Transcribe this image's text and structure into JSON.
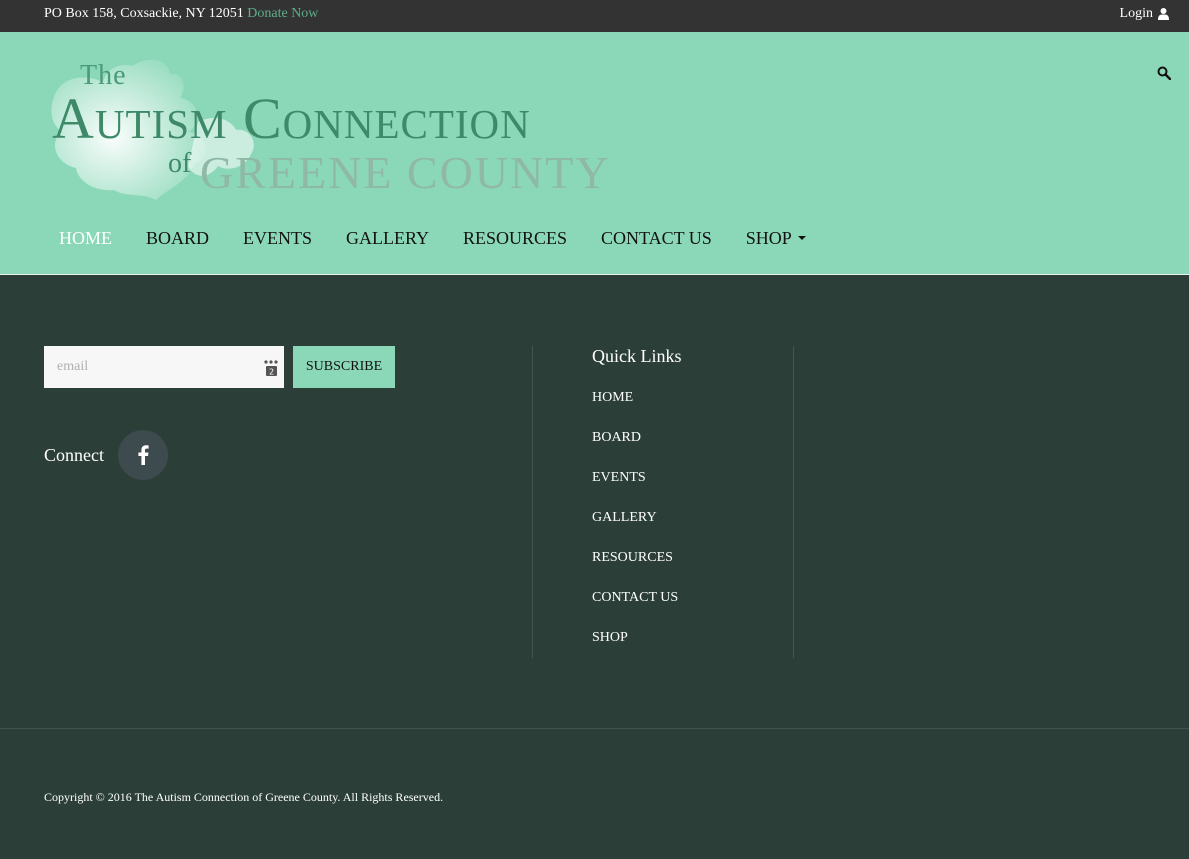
{
  "topbar": {
    "address": "PO Box 158, Coxsackie, NY 12051",
    "donate_label": "Donate Now",
    "login_label": "Login"
  },
  "logo": {
    "the": "The",
    "main": "Autism Connection",
    "of": "of",
    "county": "GREENE COUNTY"
  },
  "nav": {
    "items": [
      "HOME",
      "BOARD",
      "EVENTS",
      "GALLERY",
      "RESOURCES",
      "CONTACT US",
      "SHOP"
    ],
    "active": "HOME"
  },
  "subscribe": {
    "placeholder": "email",
    "button_label": "SUBSCRIBE"
  },
  "connect": {
    "label": "Connect"
  },
  "quick_links": {
    "title": "Quick Links",
    "items": [
      "HOME",
      "BOARD",
      "EVENTS",
      "GALLERY",
      "RESOURCES",
      "CONTACT US",
      "SHOP"
    ]
  },
  "footer": {
    "copyright": "Copyright © 2016 The Autism Connection of Greene County. All Rights Reserved."
  },
  "colors": {
    "topbar": "#333333",
    "header": "#8bd8b9",
    "footer": "#2b3f38",
    "accent_link": "#5fae8a"
  }
}
